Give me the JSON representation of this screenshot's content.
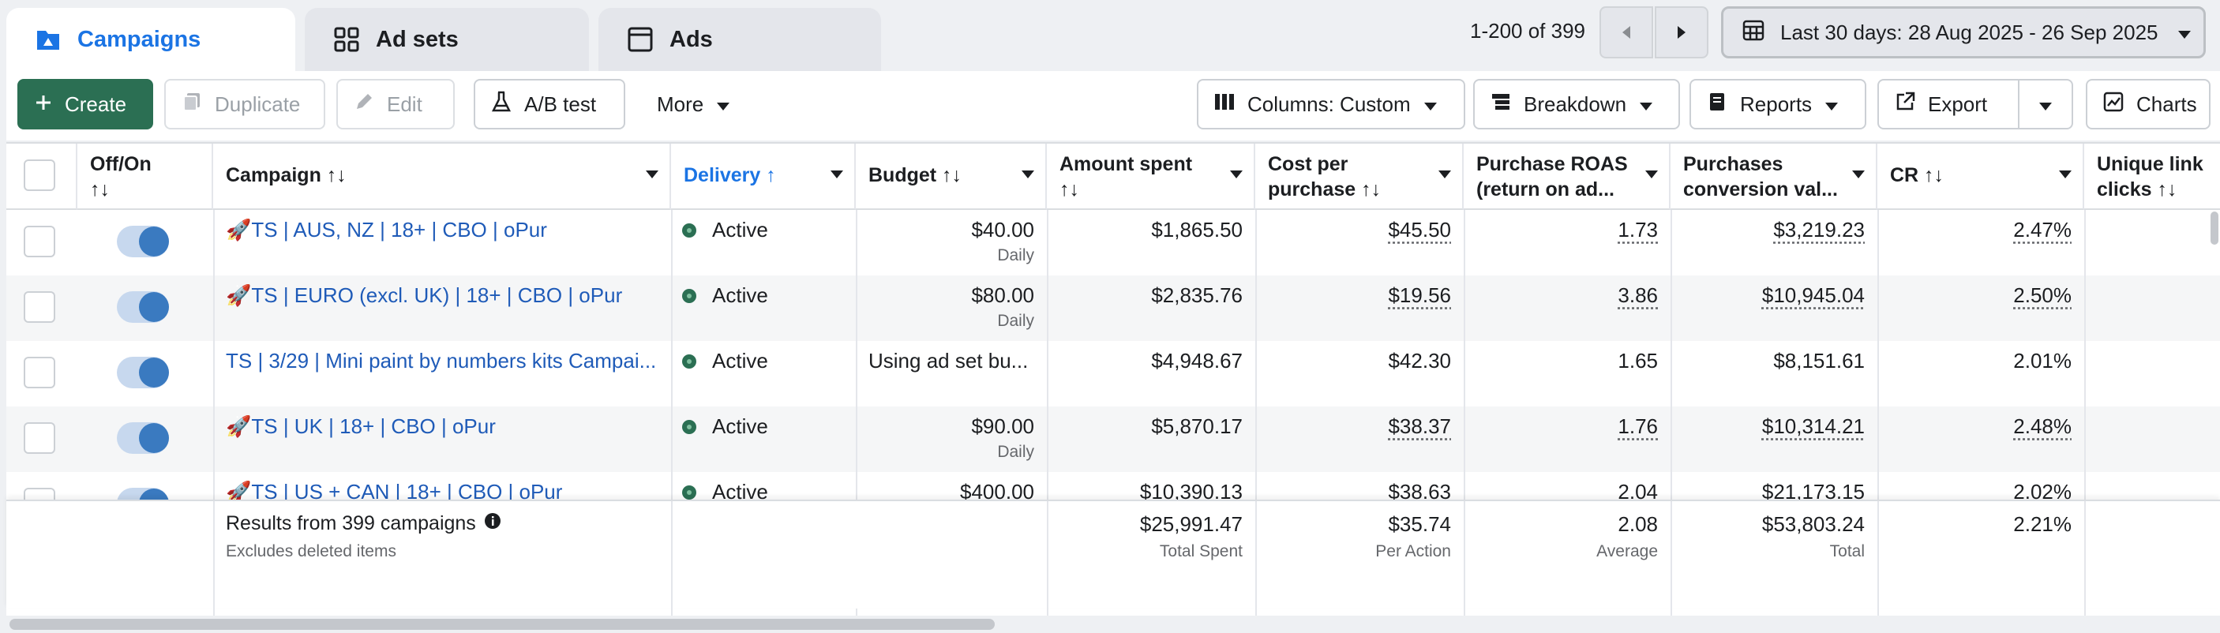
{
  "tabs": [
    {
      "label": "Campaigns",
      "icon": "folder-icon"
    },
    {
      "label": "Ad sets",
      "icon": "grid-icon"
    },
    {
      "label": "Ads",
      "icon": "window-icon"
    }
  ],
  "pagination": {
    "text": "1-200 of 399"
  },
  "date_range": {
    "label": "Last 30 days: 28 Aug 2025 - 26 Sep 2025"
  },
  "toolbar": {
    "create": "Create",
    "duplicate": "Duplicate",
    "edit": "Edit",
    "ab_test": "A/B test",
    "more": "More",
    "columns": "Columns: Custom",
    "breakdown": "Breakdown",
    "reports": "Reports",
    "export": "Export",
    "charts": "Charts"
  },
  "columns": {
    "offon_1": "Off/On",
    "offon_2": "↑↓",
    "campaign": "Campaign ↑↓",
    "delivery": "Delivery ↑",
    "budget": "Budget ↑↓",
    "amount_1": "Amount spent",
    "amount_2": "↑↓",
    "cpp_1": "Cost per",
    "cpp_2": "purchase ↑↓",
    "roas_1": "Purchase ROAS",
    "roas_2": "(return on ad...",
    "pcv_1": "Purchases",
    "pcv_2": "conversion val...",
    "cr": "CR ↑↓",
    "ulc_1": "Unique link",
    "ulc_2": "clicks ↑↓"
  },
  "rows": [
    {
      "name": "🚀TS | AUS, NZ | 18+ | CBO | oPur",
      "delivery": "Active",
      "budget": "$40.00",
      "budget_sub": "Daily",
      "spent": "$1,865.50",
      "cpp": "$45.50",
      "roas": "1.73",
      "pcv": "$3,219.23",
      "cr": "2.47%"
    },
    {
      "name": "🚀TS | EURO (excl. UK) | 18+ | CBO | oPur",
      "delivery": "Active",
      "budget": "$80.00",
      "budget_sub": "Daily",
      "spent": "$2,835.76",
      "cpp": "$19.56",
      "roas": "3.86",
      "pcv": "$10,945.04",
      "cr": "2.50%"
    },
    {
      "name": "TS | 3/29 | Mini paint by numbers kits Campai...",
      "delivery": "Active",
      "budget": "Using ad set bu...",
      "budget_sub": "",
      "spent": "$4,948.67",
      "cpp": "$42.30",
      "roas": "1.65",
      "pcv": "$8,151.61",
      "cr": "2.01%"
    },
    {
      "name": "🚀TS | UK | 18+ | CBO | oPur",
      "delivery": "Active",
      "budget": "$90.00",
      "budget_sub": "Daily",
      "spent": "$5,870.17",
      "cpp": "$38.37",
      "roas": "1.76",
      "pcv": "$10,314.21",
      "cr": "2.48%"
    },
    {
      "name": "🚀TS | US + CAN | 18+ | CBO | oPur",
      "delivery": "Active",
      "budget": "$400.00",
      "budget_sub": "",
      "spent": "$10,390.13",
      "cpp": "$38.63",
      "roas": "2.04",
      "pcv": "$21,173.15",
      "cr": "2.02%"
    }
  ],
  "footer": {
    "results": "Results from 399 campaigns",
    "excludes": "Excludes deleted items",
    "spent": "$25,991.47",
    "spent_sub": "Total Spent",
    "cpp": "$35.74",
    "cpp_sub": "Per Action",
    "roas": "2.08",
    "roas_sub": "Average",
    "pcv": "$53,803.24",
    "pcv_sub": "Total",
    "cr": "2.21%"
  },
  "colors": {
    "accent": "#1b74e4",
    "create_button": "#2b6f53",
    "link": "#1f5bb8",
    "active_dot": "#2b6f53"
  }
}
